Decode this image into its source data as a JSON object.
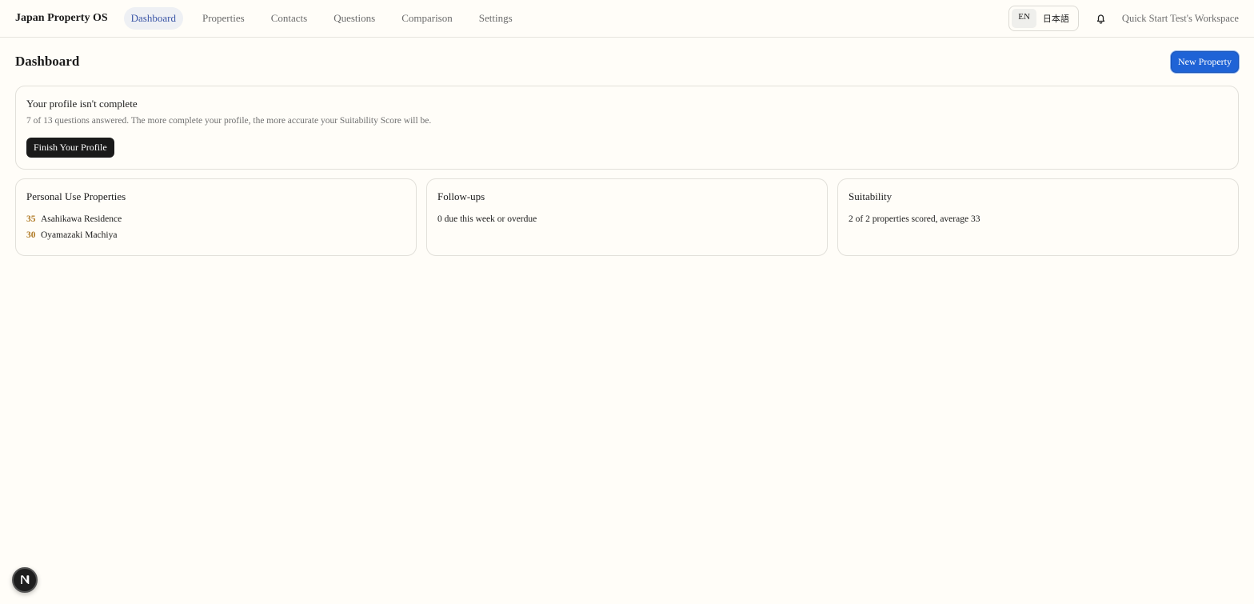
{
  "header": {
    "brand": "Japan Property OS",
    "nav": [
      {
        "label": "Dashboard",
        "active": true
      },
      {
        "label": "Properties"
      },
      {
        "label": "Contacts"
      },
      {
        "label": "Questions"
      },
      {
        "label": "Comparison"
      },
      {
        "label": "Settings"
      }
    ],
    "lang": {
      "en": "EN",
      "ja": "日本語"
    },
    "bell_icon": "bell-icon",
    "workspace": "Quick Start Test's Workspace"
  },
  "page": {
    "title": "Dashboard",
    "new_property_label": "New Property"
  },
  "profile_card": {
    "title": "Your profile isn't complete",
    "subtitle": "7 of 13 questions answered. The more complete your profile, the more accurate your Suitability Score will be.",
    "button": "Finish Your Profile"
  },
  "personal_use": {
    "title": "Personal Use Properties",
    "items": [
      {
        "score": "35",
        "name": "Asahikawa Residence"
      },
      {
        "score": "30",
        "name": "Oyamazaki Machiya"
      }
    ]
  },
  "followups": {
    "title": "Follow-ups",
    "text": "0 due this week or overdue"
  },
  "suitability": {
    "title": "Suitability",
    "text": "2 of 2 properties scored, average 33"
  },
  "colors": {
    "accent": "#1f63d6",
    "score": "#b07a25",
    "active_nav": "#3a55a6"
  }
}
